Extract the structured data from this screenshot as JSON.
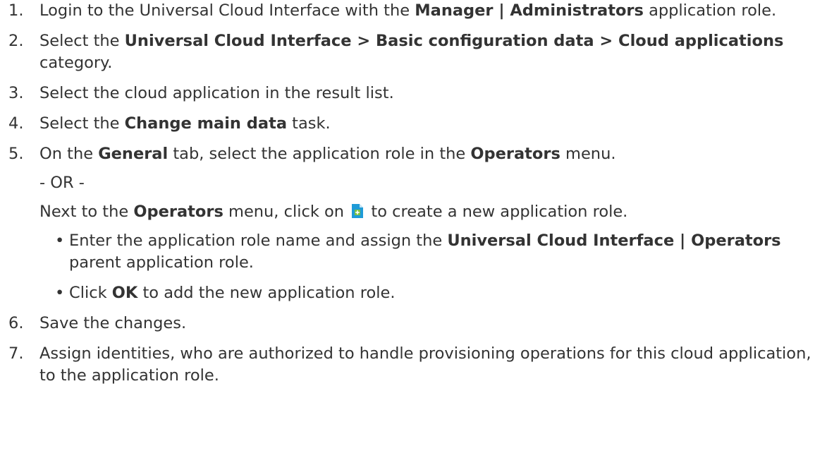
{
  "steps": [
    {
      "number": "1.",
      "parts": [
        {
          "text": "Login to the Universal Cloud Interface with the ",
          "bold": false
        },
        {
          "text": "Manager | Administrators",
          "bold": true
        },
        {
          "text": " application role.",
          "bold": false
        }
      ]
    },
    {
      "number": "2.",
      "parts": [
        {
          "text": "Select the ",
          "bold": false
        },
        {
          "text": "Universal Cloud Interface > Basic configuration data > Cloud applications",
          "bold": true
        },
        {
          "text": " category.",
          "bold": false
        }
      ]
    },
    {
      "number": "3.",
      "parts": [
        {
          "text": "Select the cloud application in the result list.",
          "bold": false
        }
      ]
    },
    {
      "number": "4.",
      "parts": [
        {
          "text": "Select the ",
          "bold": false
        },
        {
          "text": "Change main data",
          "bold": true
        },
        {
          "text": " task.",
          "bold": false
        }
      ]
    },
    {
      "number": "5.",
      "p1": [
        {
          "text": "On the ",
          "bold": false
        },
        {
          "text": "General",
          "bold": true
        },
        {
          "text": " tab, select the application role in the ",
          "bold": false
        },
        {
          "text": "Operators",
          "bold": true
        },
        {
          "text": " menu.",
          "bold": false
        }
      ],
      "or": "- OR -",
      "p3_before": [
        {
          "text": "Next to the ",
          "bold": false
        },
        {
          "text": "Operators",
          "bold": true
        },
        {
          "text": " menu, click on",
          "bold": false
        }
      ],
      "p3_after": "to create a new application role.",
      "sub": [
        [
          {
            "text": "Enter the application role name and assign the ",
            "bold": false
          },
          {
            "text": "Universal Cloud Interface | Operators",
            "bold": true
          },
          {
            "text": " parent application role.",
            "bold": false
          }
        ],
        [
          {
            "text": "Click ",
            "bold": false
          },
          {
            "text": "OK",
            "bold": true
          },
          {
            "text": " to add the new application role.",
            "bold": false
          }
        ]
      ]
    },
    {
      "number": "6.",
      "parts": [
        {
          "text": "Save the changes.",
          "bold": false
        }
      ]
    },
    {
      "number": "7.",
      "parts": [
        {
          "text": "Assign identities, who are authorized to handle provisioning operations for this cloud application, to the application role.",
          "bold": false
        }
      ]
    }
  ],
  "bullet_glyph": "•",
  "icon": {
    "name": "add-application-role-icon",
    "color": "#1f9bd7",
    "plus_color": "#7ac143"
  }
}
